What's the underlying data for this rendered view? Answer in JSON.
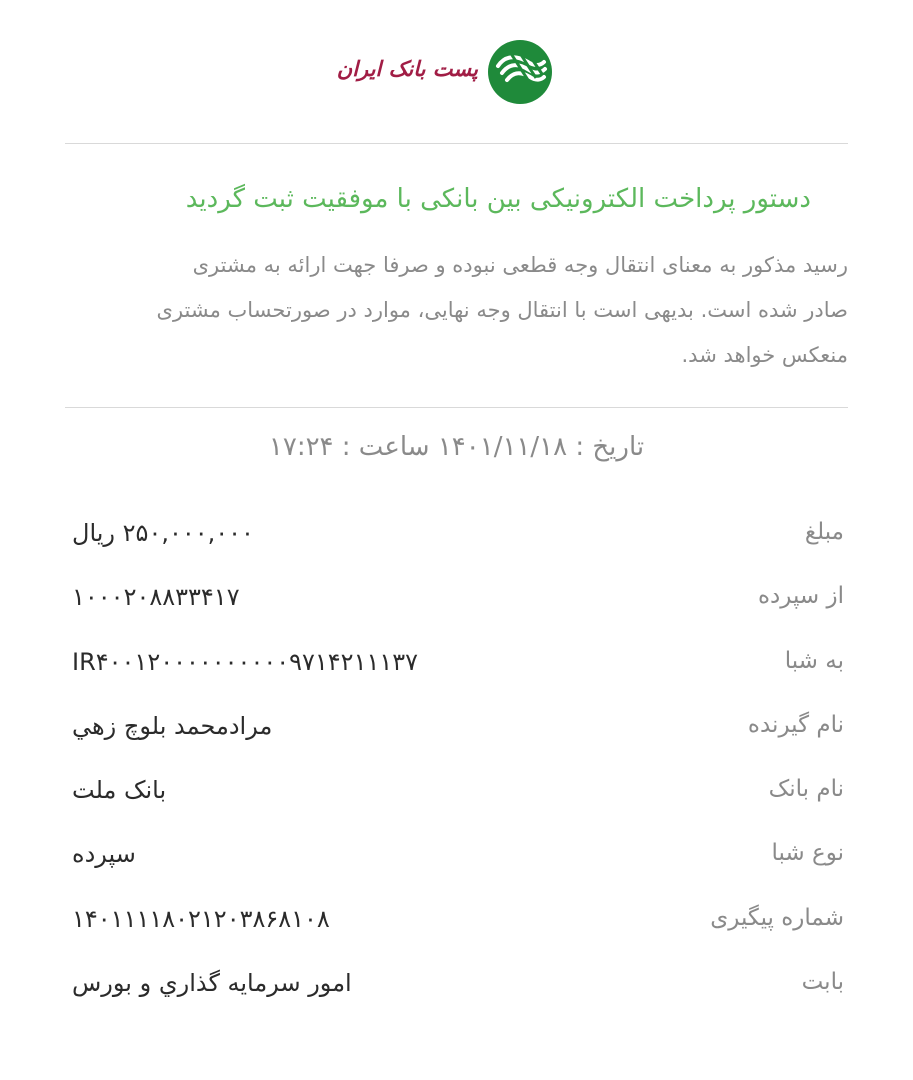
{
  "header": {
    "logo_text": "پست بانک ایران",
    "logo_icon": "post-bank-emblem-icon",
    "brand_green": "#1f8a3a",
    "brand_red": "#a11d45"
  },
  "status": {
    "title": "دستور پرداخت الکترونیکی بین بانکی با موفقیت ثبت گردید",
    "notice_line1": "رسید مذکور به معنای انتقال وجه قطعی نبوده و صرفا جهت ارائه به مشتری",
    "notice_line2": "صادر شده است. بدیهی است با انتقال وجه نهایی، موارد در صورتحساب مشتری",
    "notice_line3": "منعکس خواهد شد.",
    "color": "#5cb85c"
  },
  "date_line": "تاریخ : ۱۴۰۱/۱۱/۱۸ ساعت : ۱۷:۲۴",
  "rows": [
    {
      "label": "مبلغ",
      "value": "۲۵۰,۰۰۰,۰۰۰ ریال"
    },
    {
      "label": "از سپرده",
      "value": "۱۰۰۰۲۰۸۸۳۳۴۱۷"
    },
    {
      "label": "به شبا",
      "value": "IR۴۰۰۱۲۰۰۰۰۰۰۰۰۰۰۹۷۱۴۲۱۱۱۳۷"
    },
    {
      "label": "نام گیرنده",
      "value": "مرادمحمد بلوچ زهي"
    },
    {
      "label": "نام بانک",
      "value": "بانک  ملت"
    },
    {
      "label": "نوع شبا",
      "value": "سپرده"
    },
    {
      "label": "شماره پیگیری",
      "value": "۱۴۰۱۱۱۱۸۰۲۱۲۰۳۸۶۸۱۰۸"
    },
    {
      "label": "بابت",
      "value": "امور سرمايه گذاري و بورس"
    }
  ]
}
